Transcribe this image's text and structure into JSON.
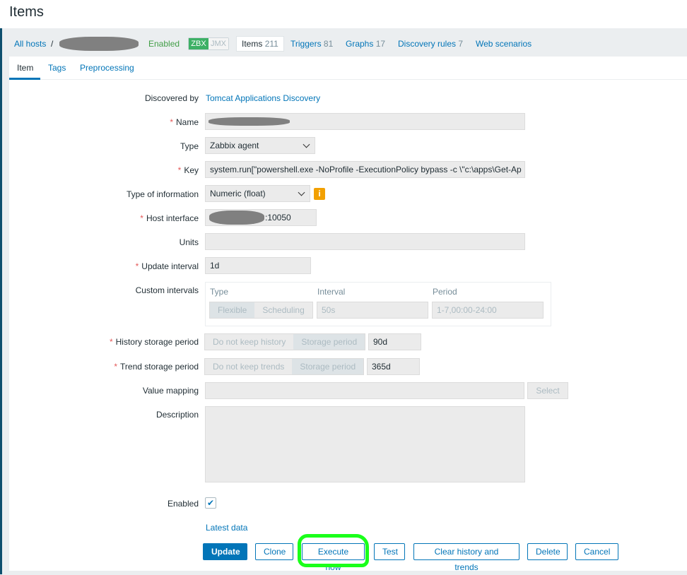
{
  "page_title": "Items",
  "breadcrumb": {
    "all_hosts": "All hosts",
    "separator": "/",
    "status": "Enabled",
    "zbx": "ZBX",
    "jmx": "JMX",
    "tabs": [
      {
        "label": "Items",
        "count": "211"
      },
      {
        "label": "Triggers",
        "count": "81"
      },
      {
        "label": "Graphs",
        "count": "17"
      },
      {
        "label": "Discovery rules",
        "count": "7"
      },
      {
        "label": "Web scenarios",
        "count": ""
      }
    ]
  },
  "form_tabs": [
    "Item",
    "Tags",
    "Preprocessing"
  ],
  "form": {
    "discovered_by_label": "Discovered by",
    "discovered_by": "Tomcat Applications Discovery",
    "name_label": "Name",
    "type_label": "Type",
    "type": "Zabbix agent",
    "key_label": "Key",
    "key": "system.run[\"powershell.exe -NoProfile -ExecutionPolicy bypass -c \\\"c:\\apps\\Get-Ap",
    "type_info_label": "Type of information",
    "type_info": "Numeric (float)",
    "info_icon": "i",
    "host_interface_label": "Host interface",
    "host_interface": ":10050",
    "units_label": "Units",
    "units": "",
    "update_interval_label": "Update interval",
    "update_interval": "1d",
    "custom_intervals_label": "Custom intervals",
    "custom": {
      "type_header": "Type",
      "interval_header": "Interval",
      "period_header": "Period",
      "flexible": "Flexible",
      "scheduling": "Scheduling",
      "interval": "50s",
      "period": "1-7,00:00-24:00"
    },
    "history_label": "History storage period",
    "history_no": "Do not keep history",
    "history_storage": "Storage period",
    "history_value": "90d",
    "trend_label": "Trend storage period",
    "trend_no": "Do not keep trends",
    "trend_storage": "Storage period",
    "trend_value": "365d",
    "value_mapping_label": "Value mapping",
    "value_mapping": "",
    "select": "Select",
    "description_label": "Description",
    "description": "",
    "enabled_label": "Enabled",
    "enabled": true,
    "latest_data": "Latest data"
  },
  "buttons": {
    "update": "Update",
    "clone": "Clone",
    "execute_now": "Execute now",
    "test": "Test",
    "clear": "Clear history and trends",
    "delete": "Delete",
    "cancel": "Cancel"
  },
  "colors": {
    "accent": "#0275b8",
    "enabled": "#429e47",
    "zbx": "#3db065",
    "highlight": "#1aff1a"
  }
}
